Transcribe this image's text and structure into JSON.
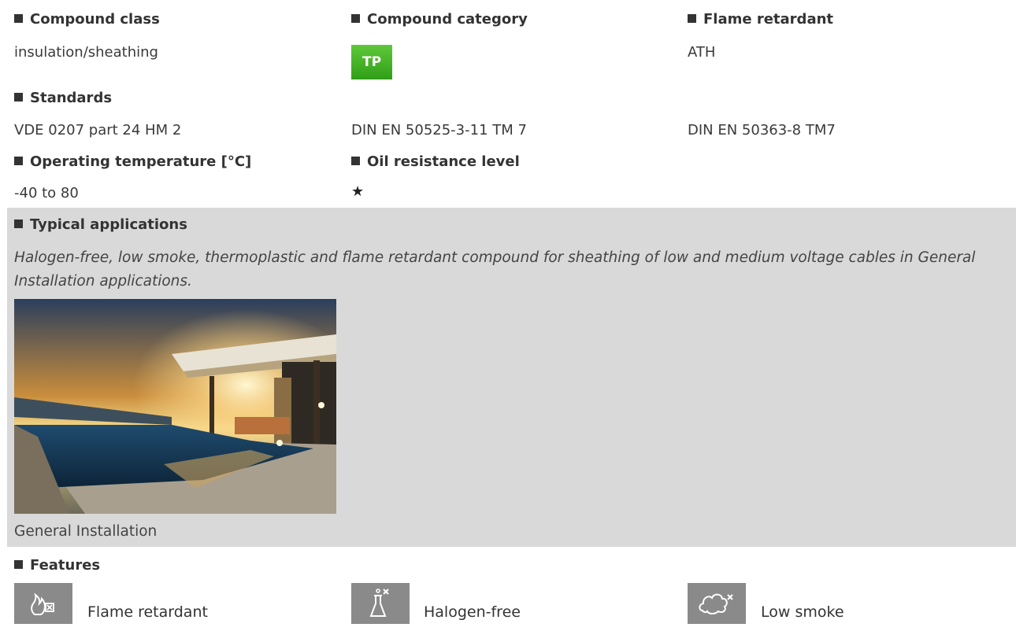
{
  "compound_class": {
    "heading": "Compound class",
    "value": "insulation/sheathing"
  },
  "compound_category": {
    "heading": "Compound category",
    "badge": "TP",
    "badge_color": "#3db021"
  },
  "flame_retardant": {
    "heading": "Flame retardant",
    "value": "ATH"
  },
  "standards": {
    "heading": "Standards",
    "items": [
      "VDE 0207 part 24 HM 2",
      "DIN EN 50525-3-11 TM 7",
      "DIN EN 50363-8 TM7"
    ]
  },
  "operating_temperature": {
    "heading": "Operating temperature [°C]",
    "value": "-40 to 80"
  },
  "oil_resistance": {
    "heading": "Oil resistance level",
    "stars": "★",
    "level": 1
  },
  "typical_applications": {
    "heading": "Typical applications",
    "description": "Halogen-free, low smoke, thermoplastic and flame retardant compound for sheathing of low and medium voltage cables in General Installation applications.",
    "image_caption": "General Installation"
  },
  "features": {
    "heading": "Features",
    "items": [
      {
        "label": "Flame retardant",
        "icon": "flame-retardant-icon"
      },
      {
        "label": "Halogen-free",
        "icon": "halogen-free-icon"
      },
      {
        "label": "Low smoke",
        "icon": "low-smoke-icon"
      }
    ]
  },
  "colors": {
    "band_grey": "#d9d9d9",
    "icon_grey": "#8a8a8a",
    "text": "#333333"
  }
}
